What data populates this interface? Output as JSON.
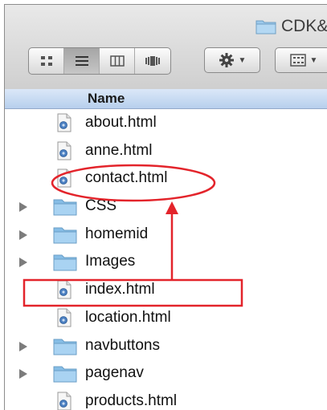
{
  "window": {
    "title": "CDK&"
  },
  "colors": {
    "annotation": "#e3242b",
    "header": "#c3d6f0",
    "folder": "#9ccaec"
  },
  "toolbar": {
    "view_buttons": [
      "icon-view-icon",
      "list-view-icon",
      "column-view-icon",
      "coverflow-view-icon"
    ],
    "active_view": "list",
    "action_button_icon": "gear-icon",
    "arrange_button_icon": "arrange-grid-icon"
  },
  "header": {
    "name_label": "Name"
  },
  "files": [
    {
      "name": "about.html",
      "kind": "file"
    },
    {
      "name": "anne.html",
      "kind": "file"
    },
    {
      "name": "contact.html",
      "kind": "file"
    },
    {
      "name": "CSS",
      "kind": "folder"
    },
    {
      "name": "homemid",
      "kind": "folder"
    },
    {
      "name": "Images",
      "kind": "folder"
    },
    {
      "name": "index.html",
      "kind": "file"
    },
    {
      "name": "location.html",
      "kind": "file"
    },
    {
      "name": "navbuttons",
      "kind": "folder"
    },
    {
      "name": "pagenav",
      "kind": "folder"
    },
    {
      "name": "products.html",
      "kind": "file"
    }
  ]
}
